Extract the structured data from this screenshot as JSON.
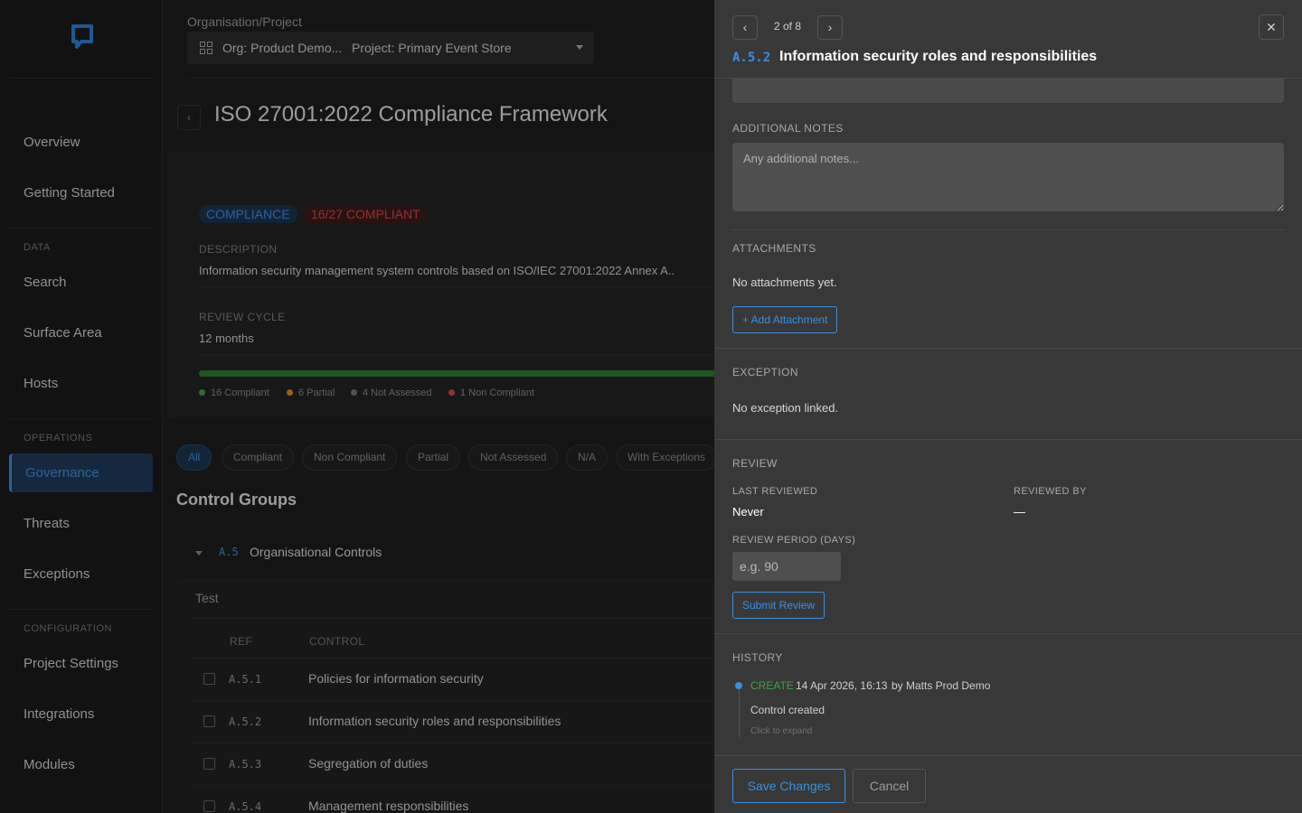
{
  "sidebar": {
    "items": {
      "overview": "Overview",
      "getting_started": "Getting Started",
      "search": "Search",
      "surface_area": "Surface Area",
      "hosts": "Hosts",
      "governance": "Governance",
      "threats": "Threats",
      "exceptions": "Exceptions",
      "project_settings": "Project Settings",
      "integrations": "Integrations",
      "modules": "Modules"
    },
    "sections": {
      "data": "DATA",
      "operations": "OPERATIONS",
      "configuration": "CONFIGURATION"
    },
    "accent": "#3a8fe0"
  },
  "header": {
    "org_label": "Organisation/Project",
    "org_value": "Org: Product Demo...",
    "project_value": "Project: Primary Event Store"
  },
  "page": {
    "title": "ISO 27001:2022 Compliance Framework",
    "badges": {
      "type": "COMPLIANCE",
      "status": "16/27 COMPLIANT"
    },
    "description_label": "DESCRIPTION",
    "description": "Information security management system controls based on ISO/IEC 27001:2022 Annex A..",
    "review_cycle_label": "REVIEW CYCLE",
    "review_cycle": "12 months",
    "compliance_fraction": 0.59,
    "legend": {
      "compliant": "16 Compliant",
      "partial": "6 Partial",
      "not_assessed": "4 Not Assessed",
      "non_compliant": "1 Non Compliant"
    },
    "status_colors": {
      "compliant": "#43a047",
      "partial": "#e08a1e",
      "not_assessed": "#777777",
      "non_compliant": "#d64545"
    },
    "filters": {
      "all": "All",
      "compliant": "Compliant",
      "non_compliant": "Non Compliant",
      "partial": "Partial",
      "not_assessed": "Not Assessed",
      "na": "N/A",
      "with_exceptions": "With Exceptions"
    },
    "control_groups_title": "Control Groups",
    "group": {
      "ref": "A.5",
      "name": "Organisational Controls",
      "sub": "Test",
      "col_ref": "REF",
      "col_control": "CONTROL",
      "rows": [
        {
          "ref": "A.5.1",
          "control": "Policies for information security"
        },
        {
          "ref": "A.5.2",
          "control": "Information security roles and responsibilities"
        },
        {
          "ref": "A.5.3",
          "control": "Segregation of duties"
        },
        {
          "ref": "A.5.4",
          "control": "Management responsibilities"
        }
      ]
    }
  },
  "panel": {
    "pager": "2 of 8",
    "ref": "A.5.2",
    "title": "Information security roles and responsibilities",
    "additional_notes_label": "ADDITIONAL NOTES",
    "additional_notes_placeholder": "Any additional notes...",
    "attachments_label": "ATTACHMENTS",
    "attachments_empty": "No attachments yet.",
    "add_attachment": "+ Add Attachment",
    "exception_label": "EXCEPTION",
    "exception_empty": "No exception linked.",
    "review_label": "REVIEW",
    "last_reviewed_label": "LAST REVIEWED",
    "last_reviewed": "Never",
    "reviewed_by_label": "REVIEWED BY",
    "reviewed_by": "—",
    "review_period_label": "REVIEW PERIOD (DAYS)",
    "review_period_placeholder": "e.g. 90",
    "submit_review": "Submit Review",
    "history_label": "HISTORY",
    "history": {
      "action": "CREATE",
      "time": "14 Apr 2026, 16:13",
      "by": "by Matts Prod Demo",
      "message": "Control created",
      "expand": "Click to expand"
    },
    "save": "Save Changes",
    "cancel": "Cancel"
  }
}
